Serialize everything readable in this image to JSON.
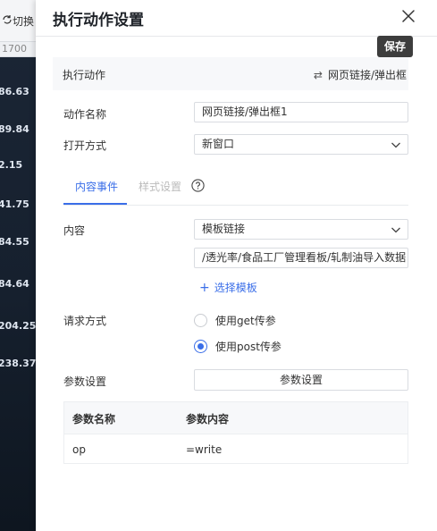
{
  "background": {
    "switch_label": "切换",
    "ruler_value": "1700",
    "values": [
      "86.63",
      "89.84",
      "2.15",
      "41.75",
      "84.55",
      "84.64",
      "204.25",
      "238.37"
    ]
  },
  "panel": {
    "title": "执行动作设置",
    "save_tooltip": "保存",
    "action": {
      "label": "执行动作",
      "value": "网页链接/弹出框"
    },
    "action_name": {
      "label": "动作名称",
      "value": "网页链接/弹出框1"
    },
    "open_mode": {
      "label": "打开方式",
      "value": "新窗口"
    },
    "tabs": [
      {
        "label": "内容事件",
        "active": true
      },
      {
        "label": "样式设置",
        "active": false
      }
    ],
    "content": {
      "label": "内容",
      "select_value": "模板链接",
      "path_value": "/透光率/食品工厂管理看板/轧制油导入数据",
      "select_template_label": "选择模板"
    },
    "request": {
      "label": "请求方式",
      "options": [
        {
          "label": "使用get传参",
          "checked": false
        },
        {
          "label": "使用post传参",
          "checked": true
        }
      ]
    },
    "params": {
      "label": "参数设置",
      "button_label": "参数设置",
      "columns": [
        "参数名称",
        "参数内容"
      ],
      "rows": [
        {
          "name": "op",
          "value": "=write"
        }
      ]
    }
  },
  "colors": {
    "accent": "#3a6ee8",
    "tooltip_bg": "#3d3d3d",
    "backdrop": "#16202e"
  },
  "icons": [
    "close-icon",
    "swap-arrows-icon",
    "chevron-down-icon",
    "help-icon",
    "plus-icon",
    "switch-icon"
  ]
}
